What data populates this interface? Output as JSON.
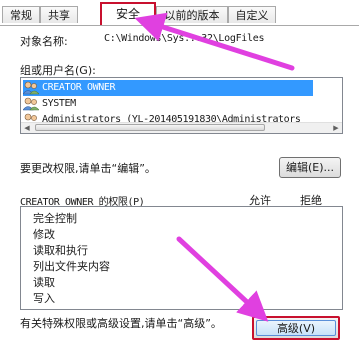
{
  "tabs": [
    {
      "label": "常规",
      "active": false
    },
    {
      "label": "共享",
      "active": false
    },
    {
      "label": "安全",
      "active": true
    },
    {
      "label": "以前的版本",
      "active": false
    },
    {
      "label": "自定义",
      "active": false
    }
  ],
  "object": {
    "label": "对象名称:",
    "value": "C:\\Windows\\Sys...32\\LogFiles"
  },
  "group_label": "组或用户名(G):",
  "users": [
    {
      "name": "CREATOR OWNER",
      "selected": true,
      "icon": "users-icon"
    },
    {
      "name": "SYSTEM",
      "selected": false,
      "icon": "users-icon"
    },
    {
      "name": "Administrators (YL-201405191830\\Administrators",
      "selected": false,
      "icon": "users-icon"
    }
  ],
  "change_label": "要更改权限,请单击“编辑”。",
  "edit_button": "编辑(E)...",
  "permissions_header": {
    "title": "CREATOR OWNER 的权限(P)",
    "allow": "允许",
    "deny": "拒绝"
  },
  "permissions": [
    "完全控制",
    "修改",
    "读取和执行",
    "列出文件夹内容",
    "读取",
    "写入"
  ],
  "special_text": "有关特殊权限或高级设置,请单击“高级”。",
  "advanced_button": "高级(V)",
  "colors": {
    "highlight": "#c8102e",
    "arrow": "#e040e0",
    "selection": "#3399ff"
  }
}
